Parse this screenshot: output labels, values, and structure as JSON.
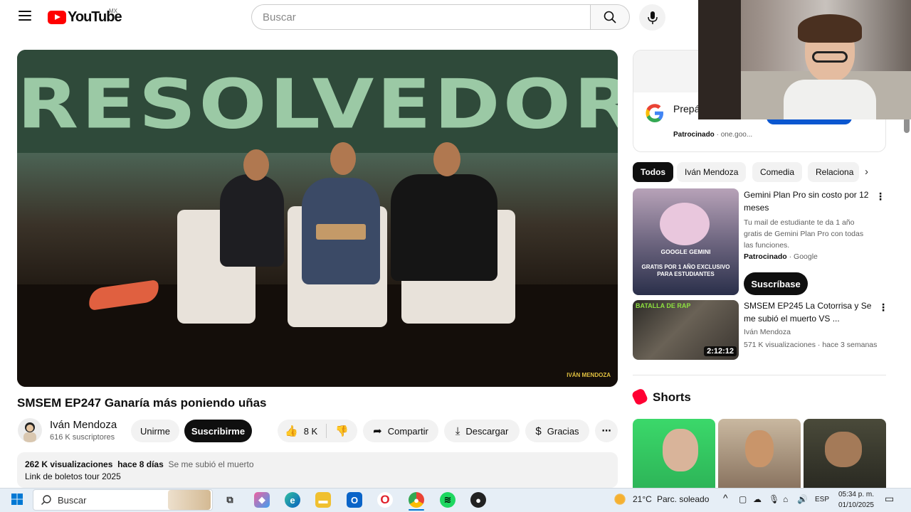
{
  "masthead": {
    "logo_text": "YouTube",
    "country_code": "MX",
    "search_placeholder": "Buscar"
  },
  "video": {
    "banner_text": "RESOLVEDORES",
    "watermark": "IVÁN MENDOZA",
    "title": "SMSEM EP247 Ganaría más poniendo uñas",
    "channel_name": "Iván Mendoza",
    "subscribers": "616 K suscriptores",
    "join_label": "Unirme",
    "subscribe_label": "Suscribirme",
    "likes": "8 K",
    "share_label": "Compartir",
    "download_label": "Descargar",
    "thanks_label": "Gracias",
    "views": "262 K visualizaciones",
    "age": "hace 8 días",
    "hashtag": "Se me subió el muerto",
    "description": "Link de boletos tour 2025"
  },
  "ad": {
    "title": "Prepá Google Gemini",
    "sponsored": "Patrocinado",
    "domain": "one.goo..."
  },
  "chips": [
    "Todos",
    "Iván Mendoza",
    "Comedia",
    "Relaciona"
  ],
  "related": [
    {
      "title": "Gemini Plan Pro sin costo por 12 meses",
      "description": "Tu mail de estudiante te da 1 año gratis de Gemini Plan Pro con todas las funciones.",
      "sponsored": "Patrocinado",
      "advertiser": "Google",
      "cta": "Suscríbase",
      "thumb_headline": "GOOGLE GEMINI",
      "thumb_sub": "GRATIS POR 1 AÑO EXCLUSIVO PARA ESTUDIANTES"
    },
    {
      "title": "SMSEM EP245 La Cotorrisa y Se me subió el muerto VS ...",
      "channel": "Iván Mendoza",
      "views": "571 K visualizaciones",
      "age": "hace 3 semanas",
      "duration": "2:12:12",
      "thumb_text": "BATALLA DE RAP"
    }
  ],
  "shorts": {
    "title": "Shorts"
  },
  "taskbar": {
    "search_text": "Buscar",
    "weather_temp": "21°C",
    "weather_desc": "Parc. soleado",
    "lang": "ESP",
    "time": "05:34 p. m.",
    "date": "01/10/2025"
  },
  "colors": {
    "brand_red": "#ff0000",
    "text_primary": "#0f0f0f",
    "chip_bg": "#f2f2f2",
    "taskbar_bg": "#e6eef6"
  }
}
